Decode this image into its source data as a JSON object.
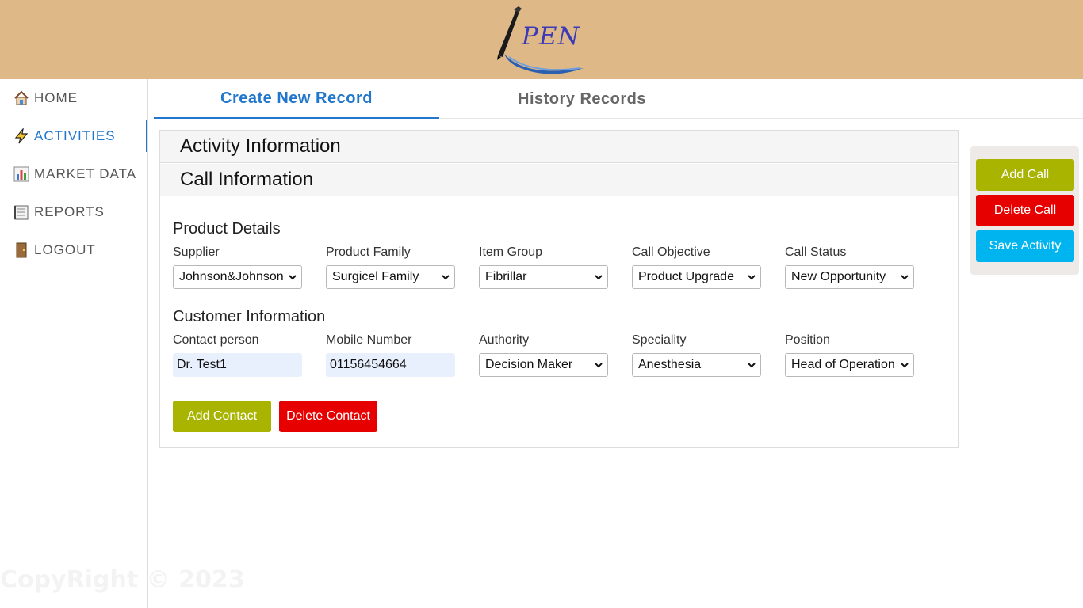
{
  "header": {
    "logo_text": "PEN",
    "bg_color": "#deb887"
  },
  "sidebar": {
    "items": [
      {
        "label": "HOME",
        "icon": "house-icon"
      },
      {
        "label": "ACTIVITIES",
        "icon": "lightning-icon",
        "active": true
      },
      {
        "label": "MARKET DATA",
        "icon": "bar-chart-icon"
      },
      {
        "label": "REPORTS",
        "icon": "notebook-icon"
      },
      {
        "label": "LOGOUT",
        "icon": "door-icon"
      }
    ],
    "copyright": "CopyRight © 2023"
  },
  "tabs": [
    {
      "label": "Create New Record",
      "active": true
    },
    {
      "label": "History Records",
      "active": false
    }
  ],
  "accordion": {
    "activity_info": "Activity Information",
    "call_info": "Call Information"
  },
  "product_details": {
    "title": "Product Details",
    "fields": [
      {
        "label": "Supplier",
        "value": "Johnson&Johnson"
      },
      {
        "label": "Product Family",
        "value": "Surgicel Family"
      },
      {
        "label": "Item Group",
        "value": "Fibrillar"
      },
      {
        "label": "Call Objective",
        "value": "Product Upgrade"
      },
      {
        "label": "Call Status",
        "value": "New Opportunity"
      }
    ]
  },
  "customer_info": {
    "title": "Customer Information",
    "contact_person": {
      "label": "Contact person",
      "value": "Dr. Test1"
    },
    "mobile_number": {
      "label": "Mobile Number",
      "value": "01156454664"
    },
    "authority": {
      "label": "Authority",
      "value": "Decision Maker"
    },
    "speciality": {
      "label": "Speciality",
      "value": "Anesthesia"
    },
    "position": {
      "label": "Position",
      "value": "Head of Operation"
    }
  },
  "contact_buttons": {
    "add": "Add Contact",
    "delete": "Delete Contact"
  },
  "actions": {
    "add_call": "Add Call",
    "delete_call": "Delete Call",
    "save_activity": "Save Activity"
  },
  "colors": {
    "accent": "#2277cc",
    "olive": "#a8b400",
    "red": "#e60000",
    "blue": "#00b4f0"
  }
}
